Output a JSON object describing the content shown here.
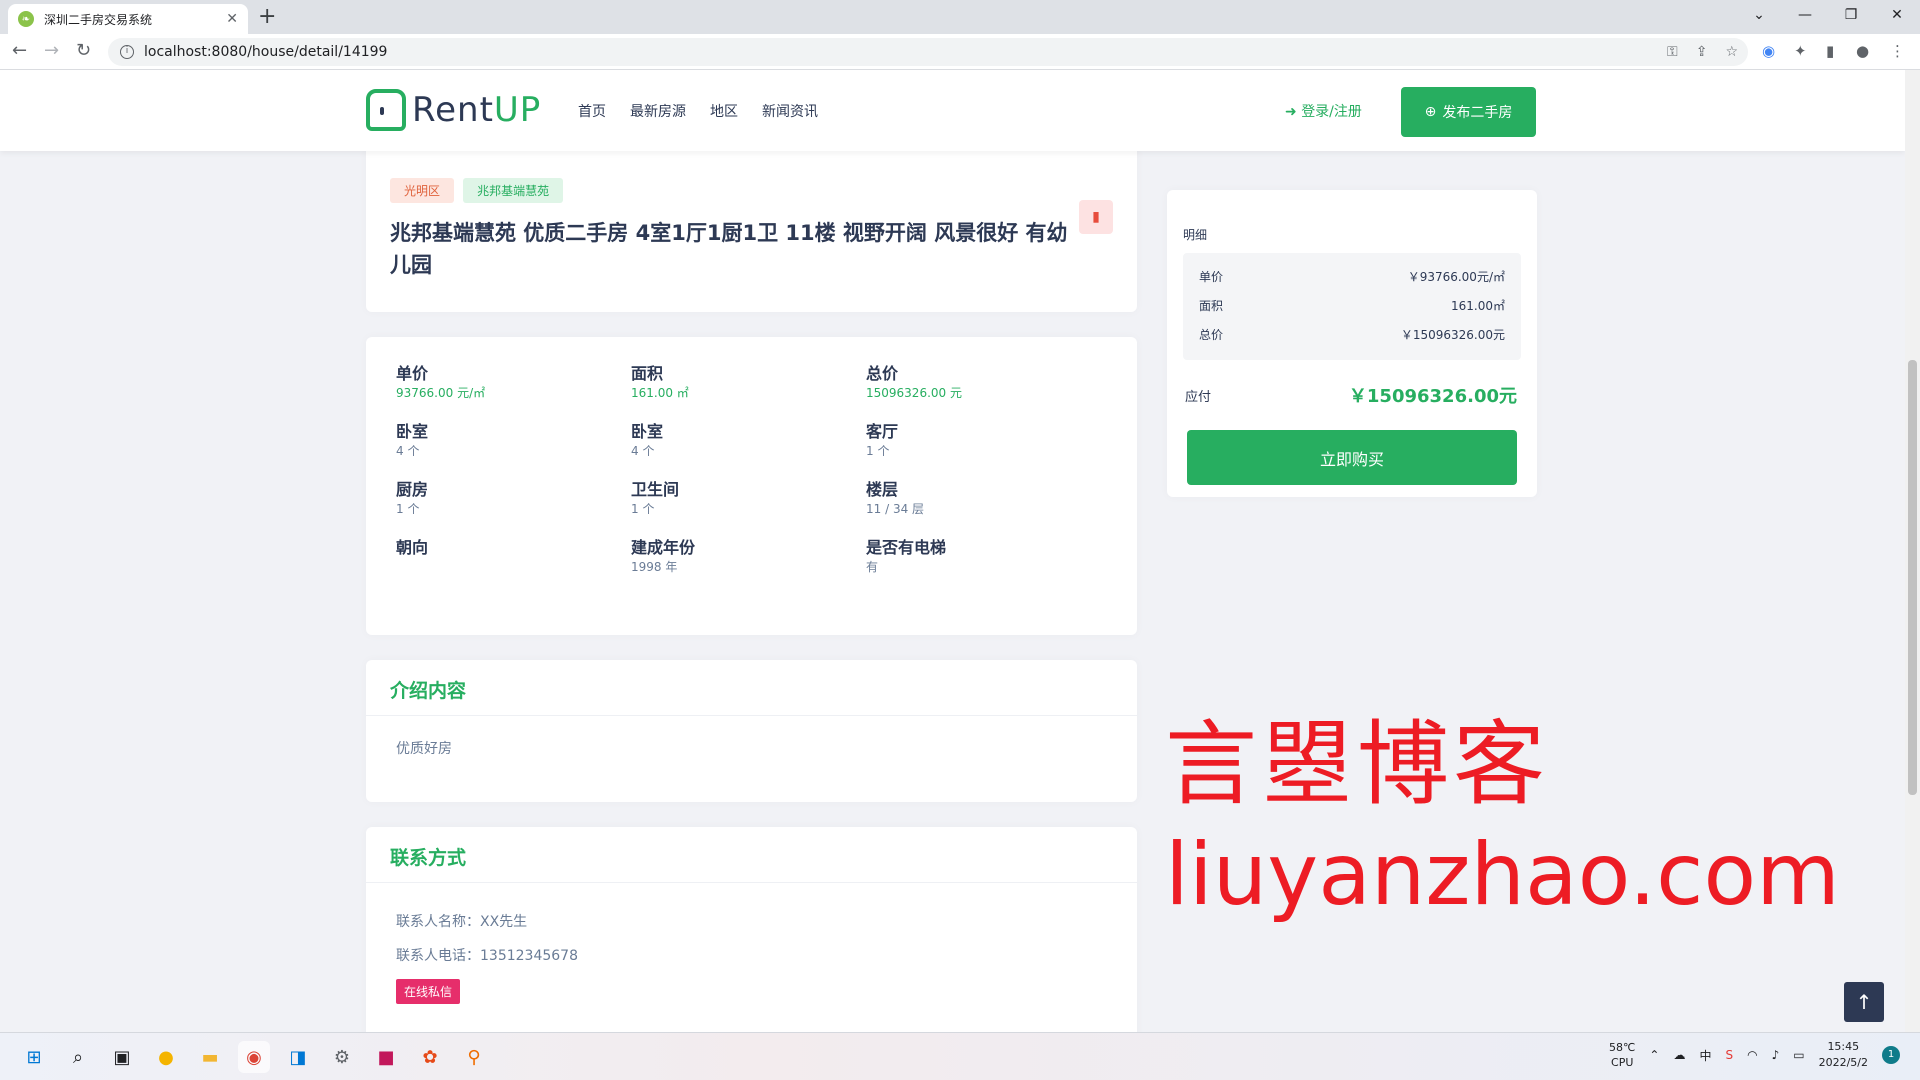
{
  "browser": {
    "tab_title": "深圳二手房交易系统",
    "tab_close": "✕",
    "new_tab": "+",
    "url": "localhost:8080/house/detail/14199",
    "window_controls": [
      "⌄",
      "—",
      "❐",
      "✕"
    ]
  },
  "header": {
    "brand_main": "Rent",
    "brand_accent": "UP",
    "menu": [
      "首页",
      "最新房源",
      "地区",
      "新闻资讯"
    ],
    "login": "登录/注册",
    "publish": "发布二手房"
  },
  "listing": {
    "tags": [
      "光明区",
      "兆邦基端慧苑"
    ],
    "title": "兆邦基端慧苑 优质二手房 4室1厅1厨1卫 11楼 视野开阔 风景很好 有幼儿园"
  },
  "features": [
    {
      "label": "单价",
      "value": "93766.00 元/㎡",
      "accent": true
    },
    {
      "label": "面积",
      "value": "161.00 ㎡",
      "accent": true
    },
    {
      "label": "总价",
      "value": "15096326.00 元",
      "accent": true
    },
    {
      "label": "卧室",
      "value": "4 个",
      "accent": false
    },
    {
      "label": "卧室",
      "value": "4 个",
      "accent": false
    },
    {
      "label": "客厅",
      "value": "1 个",
      "accent": false
    },
    {
      "label": "厨房",
      "value": "1 个",
      "accent": false
    },
    {
      "label": "卫生间",
      "value": "1 个",
      "accent": false
    },
    {
      "label": "楼层",
      "value": "11 / 34 层",
      "accent": false
    },
    {
      "label": "朝向",
      "value": "",
      "accent": false
    },
    {
      "label": "建成年份",
      "value": "1998 年",
      "accent": false
    },
    {
      "label": "是否有电梯",
      "value": "有",
      "accent": false
    }
  ],
  "intro": {
    "title": "介绍内容",
    "text": "优质好房"
  },
  "contact": {
    "title": "联系方式",
    "name_line": "联系人名称：XX先生",
    "phone_line": "联系人电话：13512345678",
    "message_button": "在线私信"
  },
  "sidebar": {
    "label": "明细",
    "rows": [
      {
        "k": "单价",
        "v": "￥93766.00元/㎡"
      },
      {
        "k": "面积",
        "v": "161.00㎡"
      },
      {
        "k": "总价",
        "v": "￥15096326.00元"
      }
    ],
    "pay_label": "应付",
    "pay_value": "￥15096326.00元",
    "buy_button": "立即购买"
  },
  "watermark": {
    "cn": "言曌博客",
    "en": "liuyanzhao.com"
  },
  "taskbar": {
    "temp": "58℃",
    "cpu": "CPU",
    "ime": "中",
    "time": "15:45",
    "date": "2022/5/2",
    "notif_count": "1"
  },
  "colors": {
    "accent": "#27ae60",
    "text": "#2d3954",
    "watermark": "#ed1c24"
  }
}
